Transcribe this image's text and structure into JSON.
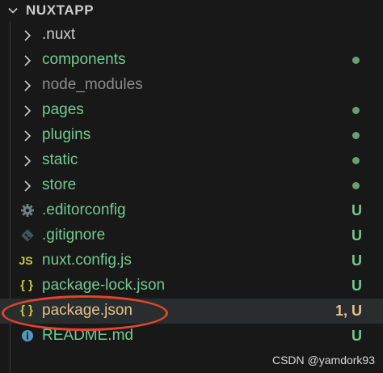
{
  "colors": {
    "background": "#181818",
    "selected_row": "#2a2d2e",
    "folder_default": "#cccccc",
    "folder_ignored": "#8c8c8c",
    "untracked_green": "#73c991",
    "modified_yellow": "#e2c08d",
    "dot": "#6b9e72",
    "annotation_red": "#e0452d",
    "js_icon": "#cbcb41",
    "json_icon": "#cbcb41",
    "gear_icon": "#6d8086",
    "git_icon": "#41535b",
    "readme_icon": "#519aba"
  },
  "explorer": {
    "title": "NUXTAPP",
    "items": [
      {
        "label": ".nuxt",
        "kind": "folder",
        "status": "default",
        "icon": "chevron-right-icon",
        "decoration": ""
      },
      {
        "label": "components",
        "kind": "folder",
        "status": "untracked",
        "icon": "chevron-right-icon",
        "decoration": "dot"
      },
      {
        "label": "node_modules",
        "kind": "folder",
        "status": "ignored",
        "icon": "chevron-right-icon",
        "decoration": ""
      },
      {
        "label": "pages",
        "kind": "folder",
        "status": "untracked",
        "icon": "chevron-right-icon",
        "decoration": "dot"
      },
      {
        "label": "plugins",
        "kind": "folder",
        "status": "untracked",
        "icon": "chevron-right-icon",
        "decoration": "dot"
      },
      {
        "label": "static",
        "kind": "folder",
        "status": "untracked",
        "icon": "chevron-right-icon",
        "decoration": "dot"
      },
      {
        "label": "store",
        "kind": "folder",
        "status": "untracked",
        "icon": "chevron-right-icon",
        "decoration": "dot"
      },
      {
        "label": ".editorconfig",
        "kind": "file",
        "status": "untracked",
        "icon": "gear-icon",
        "decoration": "U"
      },
      {
        "label": ".gitignore",
        "kind": "file",
        "status": "untracked",
        "icon": "git-icon",
        "decoration": "U"
      },
      {
        "label": "nuxt.config.js",
        "kind": "file",
        "status": "untracked",
        "icon": "js-icon",
        "icon_text": "JS",
        "decoration": "U"
      },
      {
        "label": "package-lock.json",
        "kind": "file",
        "status": "untracked",
        "icon": "json-icon",
        "icon_text": "{ }",
        "decoration": "U"
      },
      {
        "label": "package.json",
        "kind": "file",
        "status": "modified",
        "icon": "json-icon",
        "icon_text": "{ }",
        "decoration": "1, U",
        "selected": true
      },
      {
        "label": "README.md",
        "kind": "file",
        "status": "untracked",
        "icon": "info-icon",
        "decoration": "U"
      }
    ]
  },
  "watermark": "CSDN @yamdork93"
}
